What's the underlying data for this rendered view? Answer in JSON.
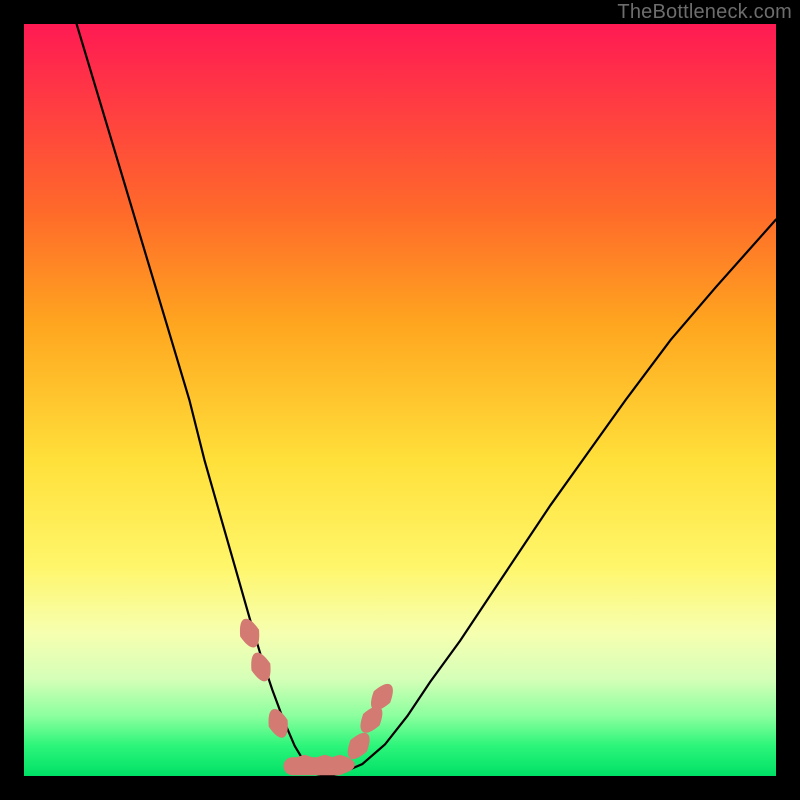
{
  "watermark": "TheBottleneck.com",
  "chart_data": {
    "type": "line",
    "title": "",
    "xlabel": "",
    "ylabel": "",
    "xlim": [
      0,
      100
    ],
    "ylim": [
      0,
      100
    ],
    "grid": false,
    "legend": false,
    "series": [
      {
        "name": "v-curve",
        "x": [
          7.0,
          10.0,
          13.0,
          16.0,
          19.0,
          22.0,
          24.0,
          26.0,
          28.0,
          30.0,
          31.5,
          33.0,
          34.5,
          36.0,
          37.5,
          39.0,
          40.5,
          42.0,
          45.0,
          48.0,
          51.0,
          54.0,
          58.0,
          62.0,
          66.0,
          70.0,
          75.0,
          80.0,
          86.0,
          92.0,
          100.0
        ],
        "y": [
          100.0,
          90.0,
          80.0,
          70.0,
          60.0,
          50.0,
          42.0,
          35.0,
          28.0,
          21.0,
          16.0,
          11.5,
          7.5,
          4.0,
          1.5,
          0.2,
          0.0,
          0.3,
          1.6,
          4.2,
          8.0,
          12.5,
          18.0,
          24.0,
          30.0,
          36.0,
          43.0,
          50.0,
          58.0,
          65.0,
          74.0
        ]
      }
    ],
    "threshold_band_y": [
      0,
      10
    ],
    "markers": {
      "name": "lozenges",
      "color": "#d37a72",
      "points_x": [
        30.0,
        31.5,
        33.8,
        37.3,
        40.0,
        42.0,
        44.5,
        46.2,
        47.6
      ],
      "points_y": [
        19.0,
        14.5,
        7.0,
        1.5,
        1.5,
        1.5,
        4.0,
        7.5,
        10.5
      ]
    }
  }
}
